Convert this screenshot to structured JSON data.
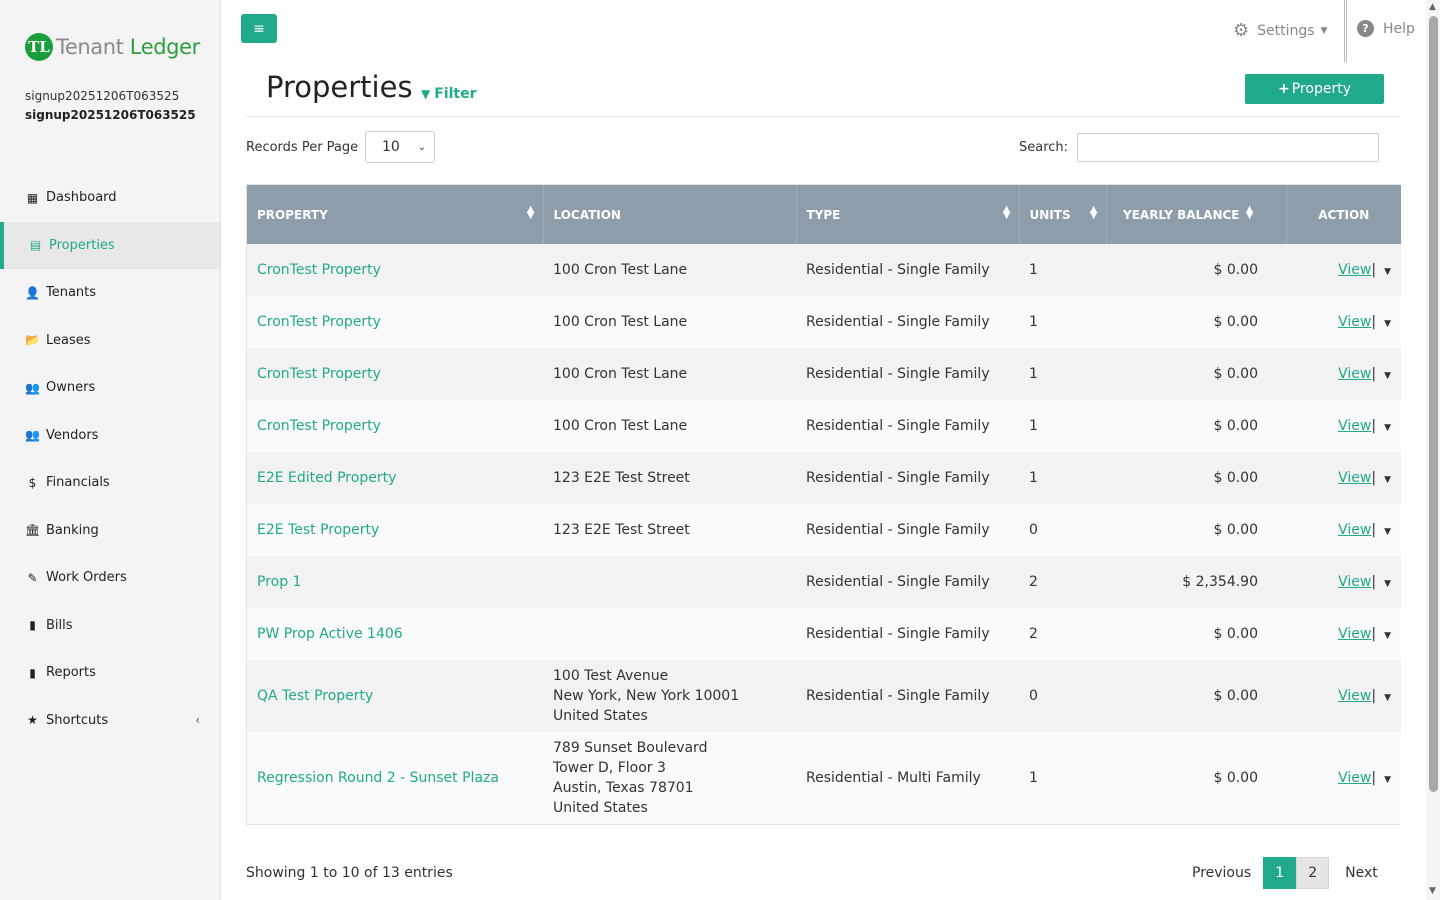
{
  "brand": {
    "logo_mark": "TL",
    "name_part1": "Tenant",
    "name_part2": " Ledger"
  },
  "user": {
    "line1": "signup20251206T063525",
    "line2": "signup20251206T063525"
  },
  "sidebar": {
    "items": [
      {
        "label": "Dashboard",
        "icon": "▦"
      },
      {
        "label": "Properties",
        "icon": "▤"
      },
      {
        "label": "Tenants",
        "icon": "👤"
      },
      {
        "label": "Leases",
        "icon": "📂"
      },
      {
        "label": "Owners",
        "icon": "👥"
      },
      {
        "label": "Vendors",
        "icon": "👥"
      },
      {
        "label": "Financials",
        "icon": "$"
      },
      {
        "label": "Banking",
        "icon": "🏛"
      },
      {
        "label": "Work Orders",
        "icon": "✎"
      },
      {
        "label": "Bills",
        "icon": "▮"
      },
      {
        "label": "Reports",
        "icon": "▮"
      },
      {
        "label": "Shortcuts",
        "icon": "★",
        "chevron": "‹"
      }
    ]
  },
  "topbar": {
    "menu_icon": "≡",
    "settings_label": "Settings",
    "help_label": "Help"
  },
  "header": {
    "title": "Properties",
    "filter_label": "Filter",
    "add_button_label": "Property"
  },
  "controls": {
    "rpp_label": "Records Per Page",
    "rpp_value": "10",
    "search_label": "Search:",
    "search_value": ""
  },
  "table": {
    "headers": {
      "property": "PROPERTY",
      "location": "LOCATION",
      "type": "TYPE",
      "units": "UNITS",
      "balance": "YEARLY BALANCE",
      "action": "ACTION"
    },
    "action_view": "View",
    "rows": [
      {
        "property": "CronTest Property",
        "location": [
          "100 Cron Test Lane"
        ],
        "type": "Residential - Single Family",
        "units": "1",
        "balance": "$ 0.00"
      },
      {
        "property": "CronTest Property",
        "location": [
          "100 Cron Test Lane"
        ],
        "type": "Residential - Single Family",
        "units": "1",
        "balance": "$ 0.00"
      },
      {
        "property": "CronTest Property",
        "location": [
          "100 Cron Test Lane"
        ],
        "type": "Residential - Single Family",
        "units": "1",
        "balance": "$ 0.00"
      },
      {
        "property": "CronTest Property",
        "location": [
          "100 Cron Test Lane"
        ],
        "type": "Residential - Single Family",
        "units": "1",
        "balance": "$ 0.00"
      },
      {
        "property": "E2E Edited Property",
        "location": [
          "123 E2E Test Street"
        ],
        "type": "Residential - Single Family",
        "units": "1",
        "balance": "$ 0.00"
      },
      {
        "property": "E2E Test Property",
        "location": [
          "123 E2E Test Street"
        ],
        "type": "Residential - Single Family",
        "units": "0",
        "balance": "$ 0.00"
      },
      {
        "property": "Prop 1",
        "location": [],
        "type": "Residential - Single Family",
        "units": "2",
        "balance": "$ 2,354.90"
      },
      {
        "property": "PW Prop Active 1406",
        "location": [],
        "type": "Residential - Single Family",
        "units": "2",
        "balance": "$ 0.00"
      },
      {
        "property": "QA Test Property",
        "location": [
          "100 Test Avenue",
          "New York, New York 10001",
          "United States"
        ],
        "type": "Residential - Single Family",
        "units": "0",
        "balance": "$ 0.00"
      },
      {
        "property": "Regression Round 2 - Sunset Plaza",
        "location": [
          "789 Sunset Boulevard",
          "Tower D, Floor 3",
          "Austin, Texas 78701",
          "United States"
        ],
        "type": "Residential - Multi Family",
        "units": "1",
        "balance": "$ 0.00"
      }
    ]
  },
  "footer": {
    "showing": "Showing 1 to 10 of 13 entries",
    "prev": "Previous",
    "pages": [
      "1",
      "2"
    ],
    "next": "Next"
  }
}
